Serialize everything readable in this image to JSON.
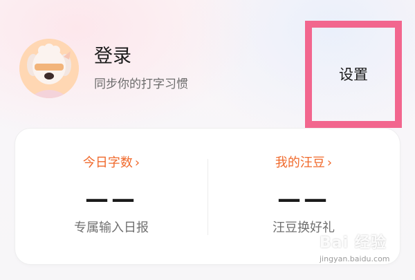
{
  "profile": {
    "title": "登录",
    "subtitle": "同步你的打字习惯",
    "avatar_icon": "dog-avatar-icon"
  },
  "header": {
    "settings_label": "设置",
    "highlight_color": "#f2668e"
  },
  "stats": [
    {
      "title": "今日字数",
      "chevron": "›",
      "value": "——",
      "caption": "专属输入日报"
    },
    {
      "title": "我的汪豆",
      "chevron": "›",
      "value": "——",
      "caption": "汪豆换好礼"
    }
  ],
  "colors": {
    "accent": "#f0692b",
    "text_primary": "#1b1b1b",
    "text_secondary": "#6f6f6f"
  },
  "watermark": {
    "brand": "Bai 经验",
    "url": "jingyan.baidu.com"
  }
}
